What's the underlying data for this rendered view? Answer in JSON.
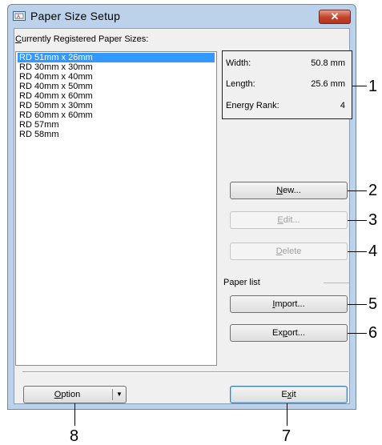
{
  "window": {
    "title": "Paper Size Setup",
    "close_glyph": "✕"
  },
  "registered_label": {
    "prefix": "C",
    "rest": "urrently Registered Paper Sizes:"
  },
  "paper_sizes": [
    "RD 51mm x 26mm",
    "RD 30mm x 30mm",
    "RD 40mm x 40mm",
    "RD 40mm x 50mm",
    "RD 40mm x 60mm",
    "RD 50mm x 30mm",
    "RD 60mm x 60mm",
    "RD 57mm",
    "RD 58mm"
  ],
  "selected_index": 0,
  "info": {
    "width_label": "Width:",
    "width_value": "50.8 mm",
    "length_label": "Length:",
    "length_value": "25.6 mm",
    "energy_label": "Energy Rank:",
    "energy_value": "4"
  },
  "buttons": {
    "new_u": "N",
    "new_rest": "ew...",
    "edit_u": "E",
    "edit_rest": "dit...",
    "delete_u": "D",
    "delete_rest": "elete",
    "import_u": "I",
    "import_rest": "mport...",
    "export_pre": "Ex",
    "export_u": "p",
    "export_rest": "ort...",
    "option_u": "O",
    "option_rest": "ption",
    "option_arrow": "▼",
    "exit_pre": "E",
    "exit_u": "x",
    "exit_rest": "it"
  },
  "paper_list_label": "Paper list",
  "callouts": [
    "1",
    "2",
    "3",
    "4",
    "5",
    "6",
    "7",
    "8"
  ],
  "colors": {
    "selection": "#3399ff",
    "close_button": "#c2412a",
    "title_bar": "#bcd2ea"
  }
}
